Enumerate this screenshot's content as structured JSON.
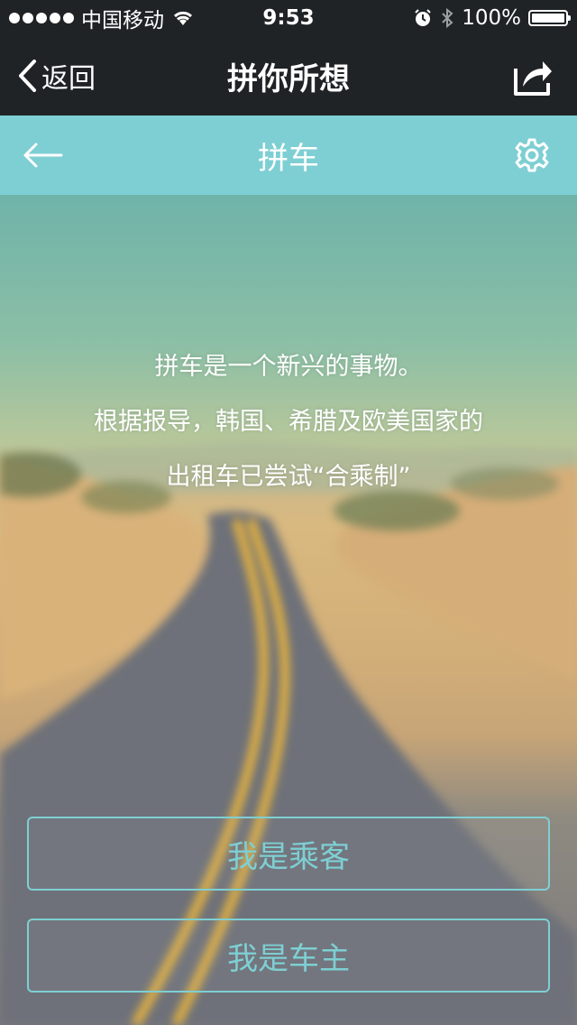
{
  "status_bar": {
    "carrier": "中国移动",
    "time": "9:53",
    "battery": "100%",
    "icons": [
      "signal-dots",
      "wifi-icon",
      "alarm-icon",
      "bluetooth-icon",
      "battery-icon"
    ]
  },
  "nav": {
    "back_label": "返回",
    "title": "拼你所想",
    "share_icon": "share-icon"
  },
  "sub": {
    "title": "拼车",
    "back_icon": "arrow-left-icon",
    "settings_icon": "gear-icon"
  },
  "intro": {
    "lines": [
      "拼车是一个新兴的事物。",
      "根据报导，韩国、希腊及欧美国家的",
      "出租车已尝试“合乘制”"
    ]
  },
  "buttons": {
    "passenger": "我是乘客",
    "driver": "我是车主"
  },
  "colors": {
    "dark_bar": "#1f2326",
    "accent": "#7ecfd3",
    "text_white": "#ffffff"
  }
}
